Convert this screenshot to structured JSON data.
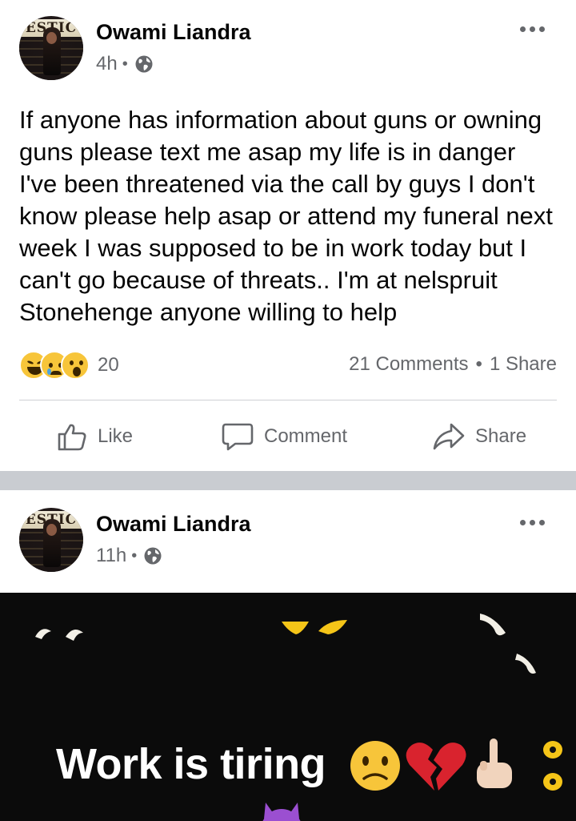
{
  "posts": [
    {
      "author": "Owami Liandra",
      "time": "4h",
      "separator": "•",
      "avatar_text": "ESTIC",
      "text": "If anyone has information about guns or owning guns please text me asap my life is in danger I've been threatened via the call by guys I don't know please help asap or attend my funeral next week I was supposed to be in work today but I can't go because of threats.. I'm at nelspruit Stonehenge anyone willing to help",
      "reactions": {
        "icons": [
          "laughing-face",
          "crying-face",
          "wow-face"
        ],
        "count": "20"
      },
      "comments": "21 Comments",
      "count_separator": "•",
      "shares": "1 Share",
      "actions": {
        "like": "Like",
        "comment": "Comment",
        "share": "Share"
      }
    },
    {
      "author": "Owami Liandra",
      "time": "11h",
      "separator": "•",
      "avatar_text": "ESTIC",
      "image": {
        "background": "#0b0b0b",
        "caption": "Work is tiring",
        "emojis": [
          "frowning-face",
          "broken-heart",
          "middle-finger",
          "smiling-devil"
        ]
      }
    }
  ],
  "colors": {
    "text": "#050505",
    "secondary_text": "#65676b",
    "divider": "#c9ccd1",
    "eye_yellow": "#f5c518"
  }
}
